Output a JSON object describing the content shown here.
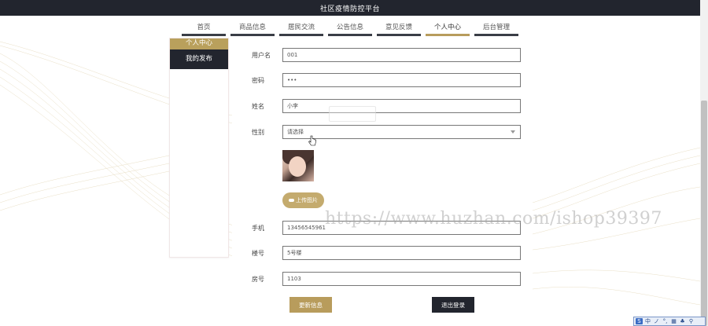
{
  "header": {
    "title": "社区疫情防控平台"
  },
  "nav": {
    "items": [
      {
        "label": "首页"
      },
      {
        "label": "商品信息"
      },
      {
        "label": "居民交流"
      },
      {
        "label": "公告信息"
      },
      {
        "label": "意见反馈"
      },
      {
        "label": "个人中心",
        "active": true
      },
      {
        "label": "后台管理"
      }
    ]
  },
  "sidebar": {
    "items": [
      {
        "label": "个人中心"
      },
      {
        "label": "我的发布"
      }
    ]
  },
  "form": {
    "username": {
      "label": "用户名",
      "value": "001"
    },
    "password": {
      "label": "密码",
      "value": "•••"
    },
    "name": {
      "label": "姓名",
      "value": "小李"
    },
    "gender": {
      "label": "性别",
      "placeholder": "请选择"
    },
    "upload_label": "上传图片",
    "phone": {
      "label": "手机",
      "value": "13456545961"
    },
    "building": {
      "label": "楼号",
      "value": "5号楼"
    },
    "room": {
      "label": "房号",
      "value": "1103"
    },
    "update_label": "更新信息",
    "logout_label": "退出登录"
  },
  "watermark": "https://www.huzhan.com/ishop39397",
  "ime": {
    "chars": [
      "中",
      "ノ",
      "°,",
      "▦",
      "♣",
      "⚲"
    ]
  },
  "colors": {
    "accent": "#b89c5c",
    "dark": "#22252e"
  }
}
